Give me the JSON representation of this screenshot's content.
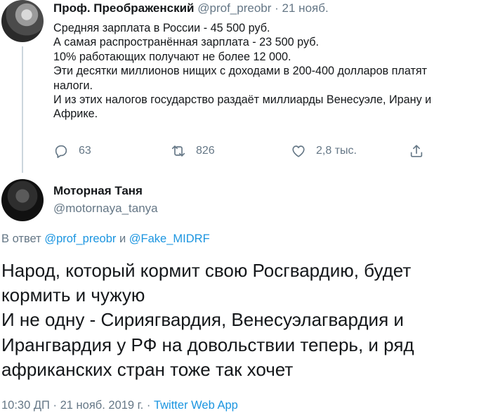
{
  "parent_tweet": {
    "name": "Проф. Преображенский",
    "handle": "@prof_preobr",
    "separator": "·",
    "date": "21 нояб.",
    "lines": [
      "Средняя зарплата в России - 45 500 руб.",
      "А самая распространённая зарплата - 23 500 руб.",
      "10% работающих получают не более 12 000.",
      "Эти десятки миллионов нищих с доходами в 200-400 долларов платят",
      "налоги.",
      "И из этих налогов государство раздаёт миллиарды Венесуэле, Ирану и",
      "Африке."
    ],
    "actions": {
      "reply_count": "63",
      "retweet_count": "826",
      "like_count": "2,8 тыс."
    },
    "icons": [
      "reply-icon",
      "retweet-icon",
      "like-icon",
      "share-icon"
    ]
  },
  "reply_tweet": {
    "name": "Моторная Таня",
    "handle": "@motornaya_tanya",
    "replying_prefix": "В ответ",
    "replying_to_1": "@prof_preobr",
    "replying_conj": "и",
    "replying_to_2": "@Fake_MIDRF",
    "lines": [
      "Народ, который кормит свою Росгвардию, будет",
      "кормить и чужую",
      "И не одну - Сириягвардия, Венесуэлагвардия и",
      "Ирангвардия у РФ на довольствии теперь, и ряд",
      "африканских стран тоже так хочет"
    ],
    "footer_time": "10:30 ДП",
    "footer_sep1": "·",
    "footer_date": "21 нояб. 2019 г.",
    "footer_sep2": "·",
    "footer_app": "Twitter Web App"
  },
  "colors": {
    "text": "#14171a",
    "secondary": "#657786",
    "link": "#1b95e0",
    "thread_line": "#ccd6dd"
  }
}
